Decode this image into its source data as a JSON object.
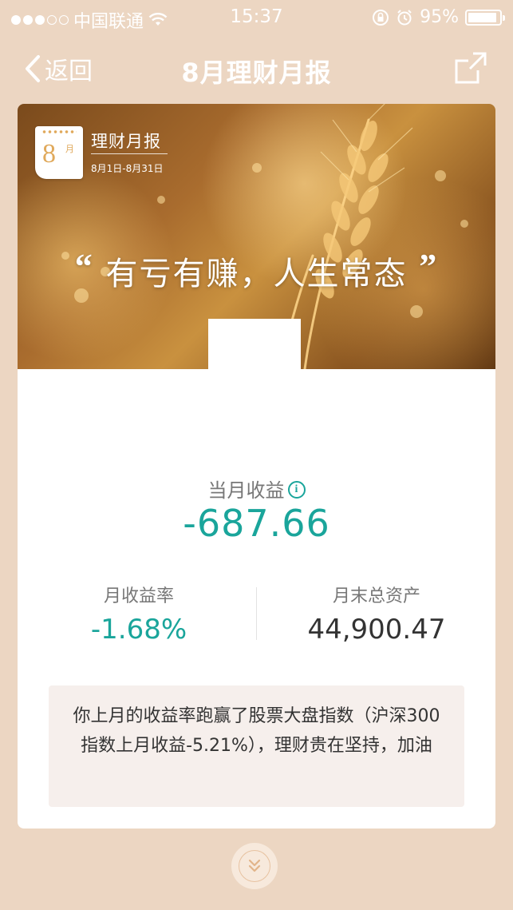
{
  "status_bar": {
    "carrier": "中国联通",
    "time": "15:37",
    "battery": "95%"
  },
  "nav": {
    "back_label": "返回",
    "title": "8月理财月报"
  },
  "hero": {
    "calendar_month": "8",
    "calendar_unit": "月",
    "report_label": "理财月报",
    "date_range": "8月1日-8月31日",
    "quote": "有亏有赚，人生常态"
  },
  "summary": {
    "income_label": "当月收益",
    "income_value": "-687.66",
    "rate_label": "月收益率",
    "rate_value": "-1.68%",
    "assets_label": "月末总资产",
    "assets_value": "44,900.47"
  },
  "message": {
    "text": "你上月的收益率跑赢了股票大盘指数（沪深300指数上月收益-5.21%），理财贵在坚持，加油"
  },
  "colors": {
    "accent": "#1aa59b",
    "background": "#ecd6c2"
  }
}
